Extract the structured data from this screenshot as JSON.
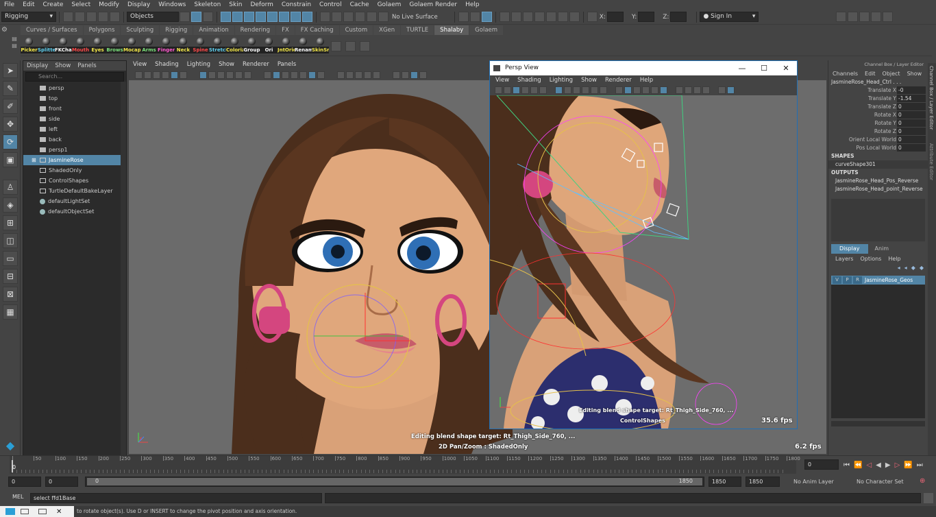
{
  "menu": [
    "File",
    "Edit",
    "Create",
    "Select",
    "Modify",
    "Display",
    "Windows",
    "Skeleton",
    "Skin",
    "Deform",
    "Constrain",
    "Control",
    "Cache",
    "Golaem",
    "Golaem Render",
    "Help"
  ],
  "status": {
    "mode": "Rigging",
    "select_mode": "Objects",
    "live_surface": "No Live Surface",
    "x_label": "X:",
    "y_label": "Y:",
    "z_label": "Z:",
    "sign_in": "Sign In"
  },
  "shelf_tabs": [
    "Curves / Surfaces",
    "Polygons",
    "Sculpting",
    "Rigging",
    "Animation",
    "Rendering",
    "FX",
    "FX Caching",
    "Custom",
    "XGen",
    "TURTLE",
    "Shalaby",
    "Golaem"
  ],
  "shelf_active": "Shalaby",
  "shelf_buttons": [
    {
      "label": "Picker",
      "color": "#f3e74a"
    },
    {
      "label": "Splitter",
      "color": "#5fd0f0"
    },
    {
      "label": "FKChain",
      "color": "#ffffff"
    },
    {
      "label": "Mouth",
      "color": "#ff4a4a"
    },
    {
      "label": "Eyes",
      "color": "#f3e74a"
    },
    {
      "label": "Brows",
      "color": "#7be07b"
    },
    {
      "label": "Mocap",
      "color": "#f3e74a"
    },
    {
      "label": "Arms",
      "color": "#7be07b"
    },
    {
      "label": "Fingers",
      "color": "#ff5ad0"
    },
    {
      "label": "Neck",
      "color": "#f3e74a"
    },
    {
      "label": "Spine",
      "color": "#ff4a4a"
    },
    {
      "label": "Stretch",
      "color": "#5fd0f0"
    },
    {
      "label": "Colorize",
      "color": "#f3e74a"
    },
    {
      "label": "Group",
      "color": "#ffffff"
    },
    {
      "label": "Ori",
      "color": "#ffffff"
    },
    {
      "label": "JntOrient",
      "color": "#f3e74a"
    },
    {
      "label": "Rename",
      "color": "#ffffff"
    },
    {
      "label": "SkinSm",
      "color": "#f3e74a"
    }
  ],
  "outliner": {
    "menu": [
      "Display",
      "Show",
      "Panels"
    ],
    "search_placeholder": "Search...",
    "items": [
      {
        "label": "persp",
        "icon": "camera-icon",
        "selected": false
      },
      {
        "label": "top",
        "icon": "camera-icon",
        "selected": false
      },
      {
        "label": "front",
        "icon": "camera-icon",
        "selected": false
      },
      {
        "label": "side",
        "icon": "camera-icon",
        "selected": false
      },
      {
        "label": "left",
        "icon": "camera-icon",
        "selected": false
      },
      {
        "label": "back",
        "icon": "camera-icon",
        "selected": false
      },
      {
        "label": "persp1",
        "icon": "camera-icon",
        "selected": false
      },
      {
        "label": "JasmineRose",
        "icon": "transform-icon",
        "selected": true
      },
      {
        "label": "ShadedOnly",
        "icon": "transform-icon",
        "selected": false
      },
      {
        "label": "ControlShapes",
        "icon": "transform-icon",
        "selected": false
      },
      {
        "label": "TurtleDefaultBakeLayer",
        "icon": "transform-icon",
        "selected": false
      },
      {
        "label": "defaultLightSet",
        "icon": "set-icon",
        "selected": false
      },
      {
        "label": "defaultObjectSet",
        "icon": "set-icon",
        "selected": false
      }
    ]
  },
  "viewport": {
    "menu": [
      "View",
      "Shading",
      "Lighting",
      "Show",
      "Renderer",
      "Panels"
    ],
    "hud_blend": "Editing blend shape target: Rt_Thigh_Side_760, ...",
    "hud_camera": "2D Pan/Zoom : ShadedOnly",
    "fps": "6.2 fps"
  },
  "persp": {
    "title": "Persp View",
    "menu": [
      "View",
      "Shading",
      "Lighting",
      "Show",
      "Renderer",
      "Help"
    ],
    "hud_blend": "Editing blend shape target: Rt_Thigh_Side_760, ...",
    "hud_camera": "ControlShapes",
    "fps": "35.6 fps"
  },
  "channel_box": {
    "header": "Channel Box / Layer Editor",
    "menu": [
      "Channels",
      "Edit",
      "Object",
      "Show"
    ],
    "object": "JasmineRose_Head_Ctrl . . .",
    "attrs": [
      {
        "name": "Translate X",
        "value": "-0"
      },
      {
        "name": "Translate Y",
        "value": "-1.54"
      },
      {
        "name": "Translate Z",
        "value": "0"
      },
      {
        "name": "Rotate X",
        "value": "0"
      },
      {
        "name": "Rotate Y",
        "value": "0"
      },
      {
        "name": "Rotate Z",
        "value": "0"
      },
      {
        "name": "Orient Local World",
        "value": "0"
      },
      {
        "name": "Pos Local World",
        "value": "0"
      }
    ],
    "shapes_label": "SHAPES",
    "shapes": [
      "curveShape301"
    ],
    "outputs_label": "OUTPUTS",
    "outputs": [
      "JasmineRose_Head_Pos_Reverse",
      "JasmineRose_Head_point_Reverse"
    ],
    "side_tabs": [
      "Channel Box / Layer Editor",
      "Attribute Editor"
    ]
  },
  "layer_editor": {
    "tabs": [
      "Display",
      "Anim"
    ],
    "menu": [
      "Layers",
      "Options",
      "Help"
    ],
    "layer": {
      "v": "V",
      "p": "P",
      "r": "R",
      "name": "JasmineRose_Geos"
    }
  },
  "time": {
    "ticks": [
      "0",
      "50",
      "100",
      "150",
      "200",
      "250",
      "300",
      "350",
      "400",
      "450",
      "500",
      "550",
      "600",
      "650",
      "700",
      "750",
      "800",
      "850",
      "900",
      "950",
      "1000",
      "1050",
      "1100",
      "1150",
      "1200",
      "1250",
      "1300",
      "1350",
      "1400",
      "1450",
      "1500",
      "1550",
      "1600",
      "1650",
      "1700",
      "1750",
      "1800"
    ],
    "current_frame": "0",
    "range_start": "0",
    "range_start2": "0",
    "range_inner_start": "0",
    "range_inner_end": "1850",
    "range_end": "1850",
    "range_end2": "1850",
    "anim_layer": "No Anim Layer",
    "char_set": "No Character Set"
  },
  "command": {
    "lang": "MEL",
    "text": "select ffd1Base"
  },
  "help": {
    "text": "to rotate object(s). Use D or INSERT to change the pivot position and axis orientation."
  },
  "colors": {
    "accent": "#5285a6",
    "selection": "#5285a6",
    "bg": "#444444"
  }
}
